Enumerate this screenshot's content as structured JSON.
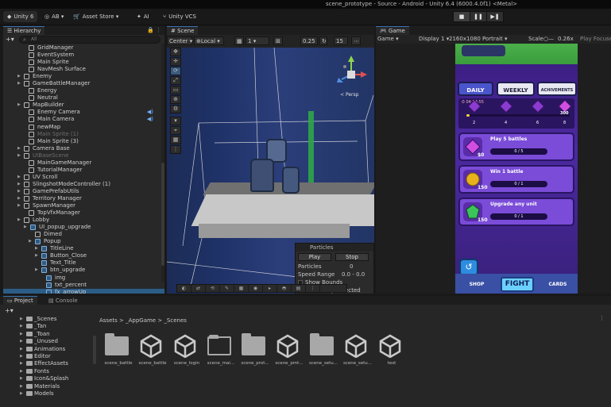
{
  "window": {
    "title": "scene_prototype - Source - Android - Unity 6.4 (6000.4.0f1) <Metal>"
  },
  "toolbar": {
    "unity_label": "Unity 6",
    "account_label": "AB",
    "asset_store_label": "Asset Store",
    "ai_label": "AI",
    "vcs_label": "Unity VCS"
  },
  "hierarchy": {
    "tab": "Hierarchy",
    "search_placeholder": "All",
    "items": [
      {
        "label": "GridManager"
      },
      {
        "label": "EventSystem"
      },
      {
        "label": "Main Sprite"
      },
      {
        "label": "NavMesh Surface"
      },
      {
        "label": "Enemy"
      },
      {
        "label": "GameBattleManager"
      },
      {
        "label": "Energy"
      },
      {
        "label": "Neutral"
      },
      {
        "label": "MapBuilder"
      },
      {
        "label": "Enemy Camera"
      },
      {
        "label": "Main Camera"
      },
      {
        "label": "newMap"
      },
      {
        "label": "Main Sprite (1)"
      },
      {
        "label": "Main Sprite (3)"
      },
      {
        "label": "Camera Base"
      },
      {
        "label": "UIBaseScene"
      },
      {
        "label": "MainGameManager"
      },
      {
        "label": "TutorialManager"
      },
      {
        "label": "UV Scroll"
      },
      {
        "label": "SlingshotModeController (1)"
      },
      {
        "label": "GamePrefabUtils"
      },
      {
        "label": "Territory Manager"
      },
      {
        "label": "SpawnManager"
      },
      {
        "label": "TopVfxManager"
      },
      {
        "label": "Lobby"
      },
      {
        "label": "UI_popup_upgrade"
      },
      {
        "label": "Dimed"
      },
      {
        "label": "Popup"
      },
      {
        "label": "TitleLine"
      },
      {
        "label": "Button_Close"
      },
      {
        "label": "Text_Title"
      },
      {
        "label": "btn_upgrade"
      },
      {
        "label": "img"
      },
      {
        "label": "txt_percent"
      },
      {
        "label": "fx_arrowUp"
      }
    ]
  },
  "scene": {
    "tab": "Scene",
    "pivot_label": "Center",
    "space_label": "Local",
    "grid_value": "1",
    "snap_value": "0.25",
    "angle_value": "15",
    "persp_label": "Persp",
    "particles": {
      "title": "Particles",
      "play_label": "Play",
      "stop_label": "Stop",
      "particles_label": "Particles",
      "particles_value": "0",
      "speed_label": "Speed Range",
      "speed_value": "0.0 - 0.0",
      "show_bounds": "Show Bounds",
      "show_only_selected": "Show Only Selected"
    }
  },
  "game": {
    "tab": "Game",
    "mode_label": "Game",
    "display_label": "Display 1",
    "resolution_label": "2160x1080 Portrait",
    "scale_label": "Scale",
    "scale_value": "0.26x",
    "play_focused_label": "Play Focuse",
    "tabs": [
      "DAILY",
      "WEEKLY",
      "ACHIVEMENTS"
    ],
    "timer": "04:54:55",
    "progress_fraction": 0.03,
    "milestones": [
      {
        "label": "2"
      },
      {
        "label": "4"
      },
      {
        "label": "6"
      },
      {
        "label": "8"
      }
    ],
    "milestone_reward": "300",
    "quests": [
      {
        "title": "Play 5 battles",
        "reward": "$0",
        "count": "0 / 5",
        "color": "#8a3fd6"
      },
      {
        "title": "Win 1 battle",
        "reward": "150",
        "count": "0 / 1",
        "color": "#e7b21c"
      },
      {
        "title": "Upgrade any unit",
        "reward": "150",
        "count": "0 / 1",
        "color": "#3bc45a"
      }
    ],
    "nav": {
      "shop": "SHOP",
      "fight": "FIGHT",
      "cards": "CARDS"
    }
  },
  "project": {
    "tabs": [
      "Project",
      "Console"
    ],
    "tree": [
      {
        "label": "_Scenes"
      },
      {
        "label": "_Tan"
      },
      {
        "label": "_Toan"
      },
      {
        "label": "_Unused"
      },
      {
        "label": "Animations"
      },
      {
        "label": "Editor"
      },
      {
        "label": "EffectAssets"
      },
      {
        "label": "Fonts"
      },
      {
        "label": "Icon&Splash"
      },
      {
        "label": "Materials"
      },
      {
        "label": "Models"
      }
    ],
    "breadcrumb": "Assets > _AppGame > _Scenes",
    "assets": [
      {
        "name": "scene_battle",
        "type": "folder"
      },
      {
        "name": "scene_battle",
        "type": "unity"
      },
      {
        "name": "scene_login",
        "type": "unity"
      },
      {
        "name": "scene_mai...",
        "type": "folder-outline"
      },
      {
        "name": "scene_prot...",
        "type": "folder"
      },
      {
        "name": "scene_pmt...",
        "type": "unity"
      },
      {
        "name": "scene_setu...",
        "type": "folder"
      },
      {
        "name": "scene_setu...",
        "type": "unity"
      },
      {
        "name": "test",
        "type": "unity"
      }
    ]
  }
}
